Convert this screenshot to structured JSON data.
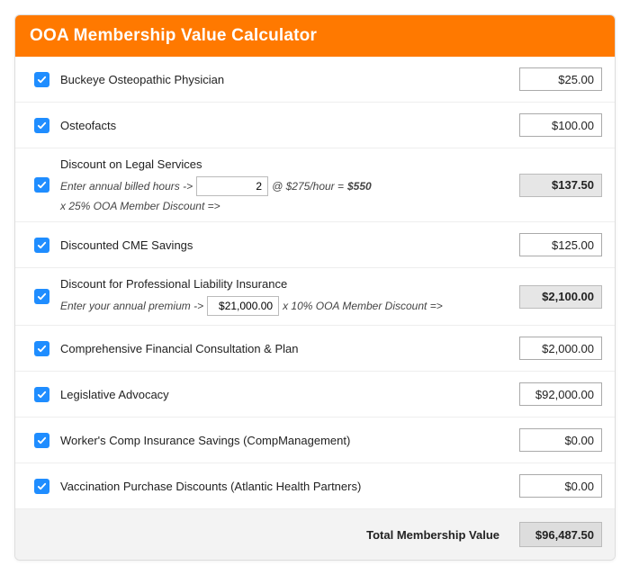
{
  "header": {
    "title": "OOA Membership Value Calculator"
  },
  "rows": [
    {
      "checked": true,
      "label": "Buckeye Osteopathic Physician",
      "value": "$25.00",
      "computed": false
    },
    {
      "checked": true,
      "label": "Osteofacts",
      "value": "$100.00",
      "computed": false
    },
    {
      "checked": true,
      "label": "Discount on Legal Services",
      "value": "$137.50",
      "computed": true,
      "sub": {
        "prefix": "Enter annual billed hours ->",
        "input_value": "2",
        "mid1": "@ $275/hour = ",
        "bold": "$550",
        "mid2": " x 25% OOA Member Discount =>"
      }
    },
    {
      "checked": true,
      "label": "Discounted CME Savings",
      "value": "$125.00",
      "computed": false
    },
    {
      "checked": true,
      "label": "Discount for Professional Liability Insurance",
      "value": "$2,100.00",
      "computed": true,
      "sub": {
        "prefix": "Enter your annual premium ->",
        "input_value": "$21,000.00",
        "mid1": "x 10% OOA Member Discount =>",
        "bold": "",
        "mid2": ""
      }
    },
    {
      "checked": true,
      "label": "Comprehensive Financial Consultation & Plan",
      "value": "$2,000.00",
      "computed": false
    },
    {
      "checked": true,
      "label": "Legislative Advocacy",
      "value": "$92,000.00",
      "computed": false
    },
    {
      "checked": true,
      "label": "Worker's Comp Insurance Savings (CompManagement)",
      "value": "$0.00",
      "computed": false
    },
    {
      "checked": true,
      "label": "Vaccination Purchase Discounts (Atlantic Health Partners)",
      "value": "$0.00",
      "computed": false
    }
  ],
  "footer": {
    "label": "Total Membership Value",
    "total": "$96,487.50"
  }
}
